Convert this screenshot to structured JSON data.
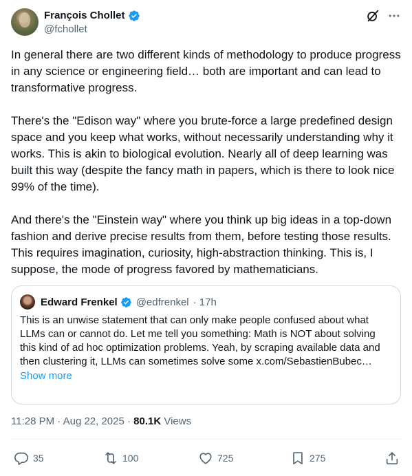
{
  "author": {
    "name": "François Chollet",
    "handle": "@fchollet",
    "verified_color": "#1d9bf0"
  },
  "header_icons": [
    "grok-icon",
    "more-icon"
  ],
  "body": {
    "paragraphs": [
      "In general there are two different kinds of methodology to produce progress in any science or engineering field… both are important and can lead to transformative progress.",
      "There's the \"Edison way\" where you brute-force a large predefined design space and you keep what works, without necessarily understanding why it works. This is akin to biological evolution. Nearly all of deep learning was built this way (despite the fancy math in papers, which is there to look nice 99% of the time).",
      "And there's the \"Einstein way\" where you think up big ideas in a top-down fashion and derive precise results from them, before testing those results. This requires imagination, curiosity, high-abstraction thinking. This is, I suppose, the mode of progress favored by mathematicians."
    ]
  },
  "quote": {
    "name": "Edward Frenkel",
    "handle": "@edfrenkel",
    "time": "· 17h",
    "text": "This is an unwise statement that can only make people confused about what LLMs can or cannot do. Let me tell you something: Math is NOT about solving this kind of ad hoc optimization problems. Yeah, by scraping available data and then clustering it, LLMs can sometimes solve some x.com/SebastienBubec…",
    "show_more": "Show more"
  },
  "meta": {
    "time": "11:28 PM · Aug 22, 2025 · ",
    "views_count": "80.1K",
    "views_label": " Views"
  },
  "actions": {
    "replies": "35",
    "reposts": "100",
    "likes": "725",
    "bookmarks": "275"
  },
  "colors": {
    "text": "#0f1419",
    "secondary": "#536471",
    "accent": "#1d9bf0",
    "border": "#cfd9de"
  }
}
